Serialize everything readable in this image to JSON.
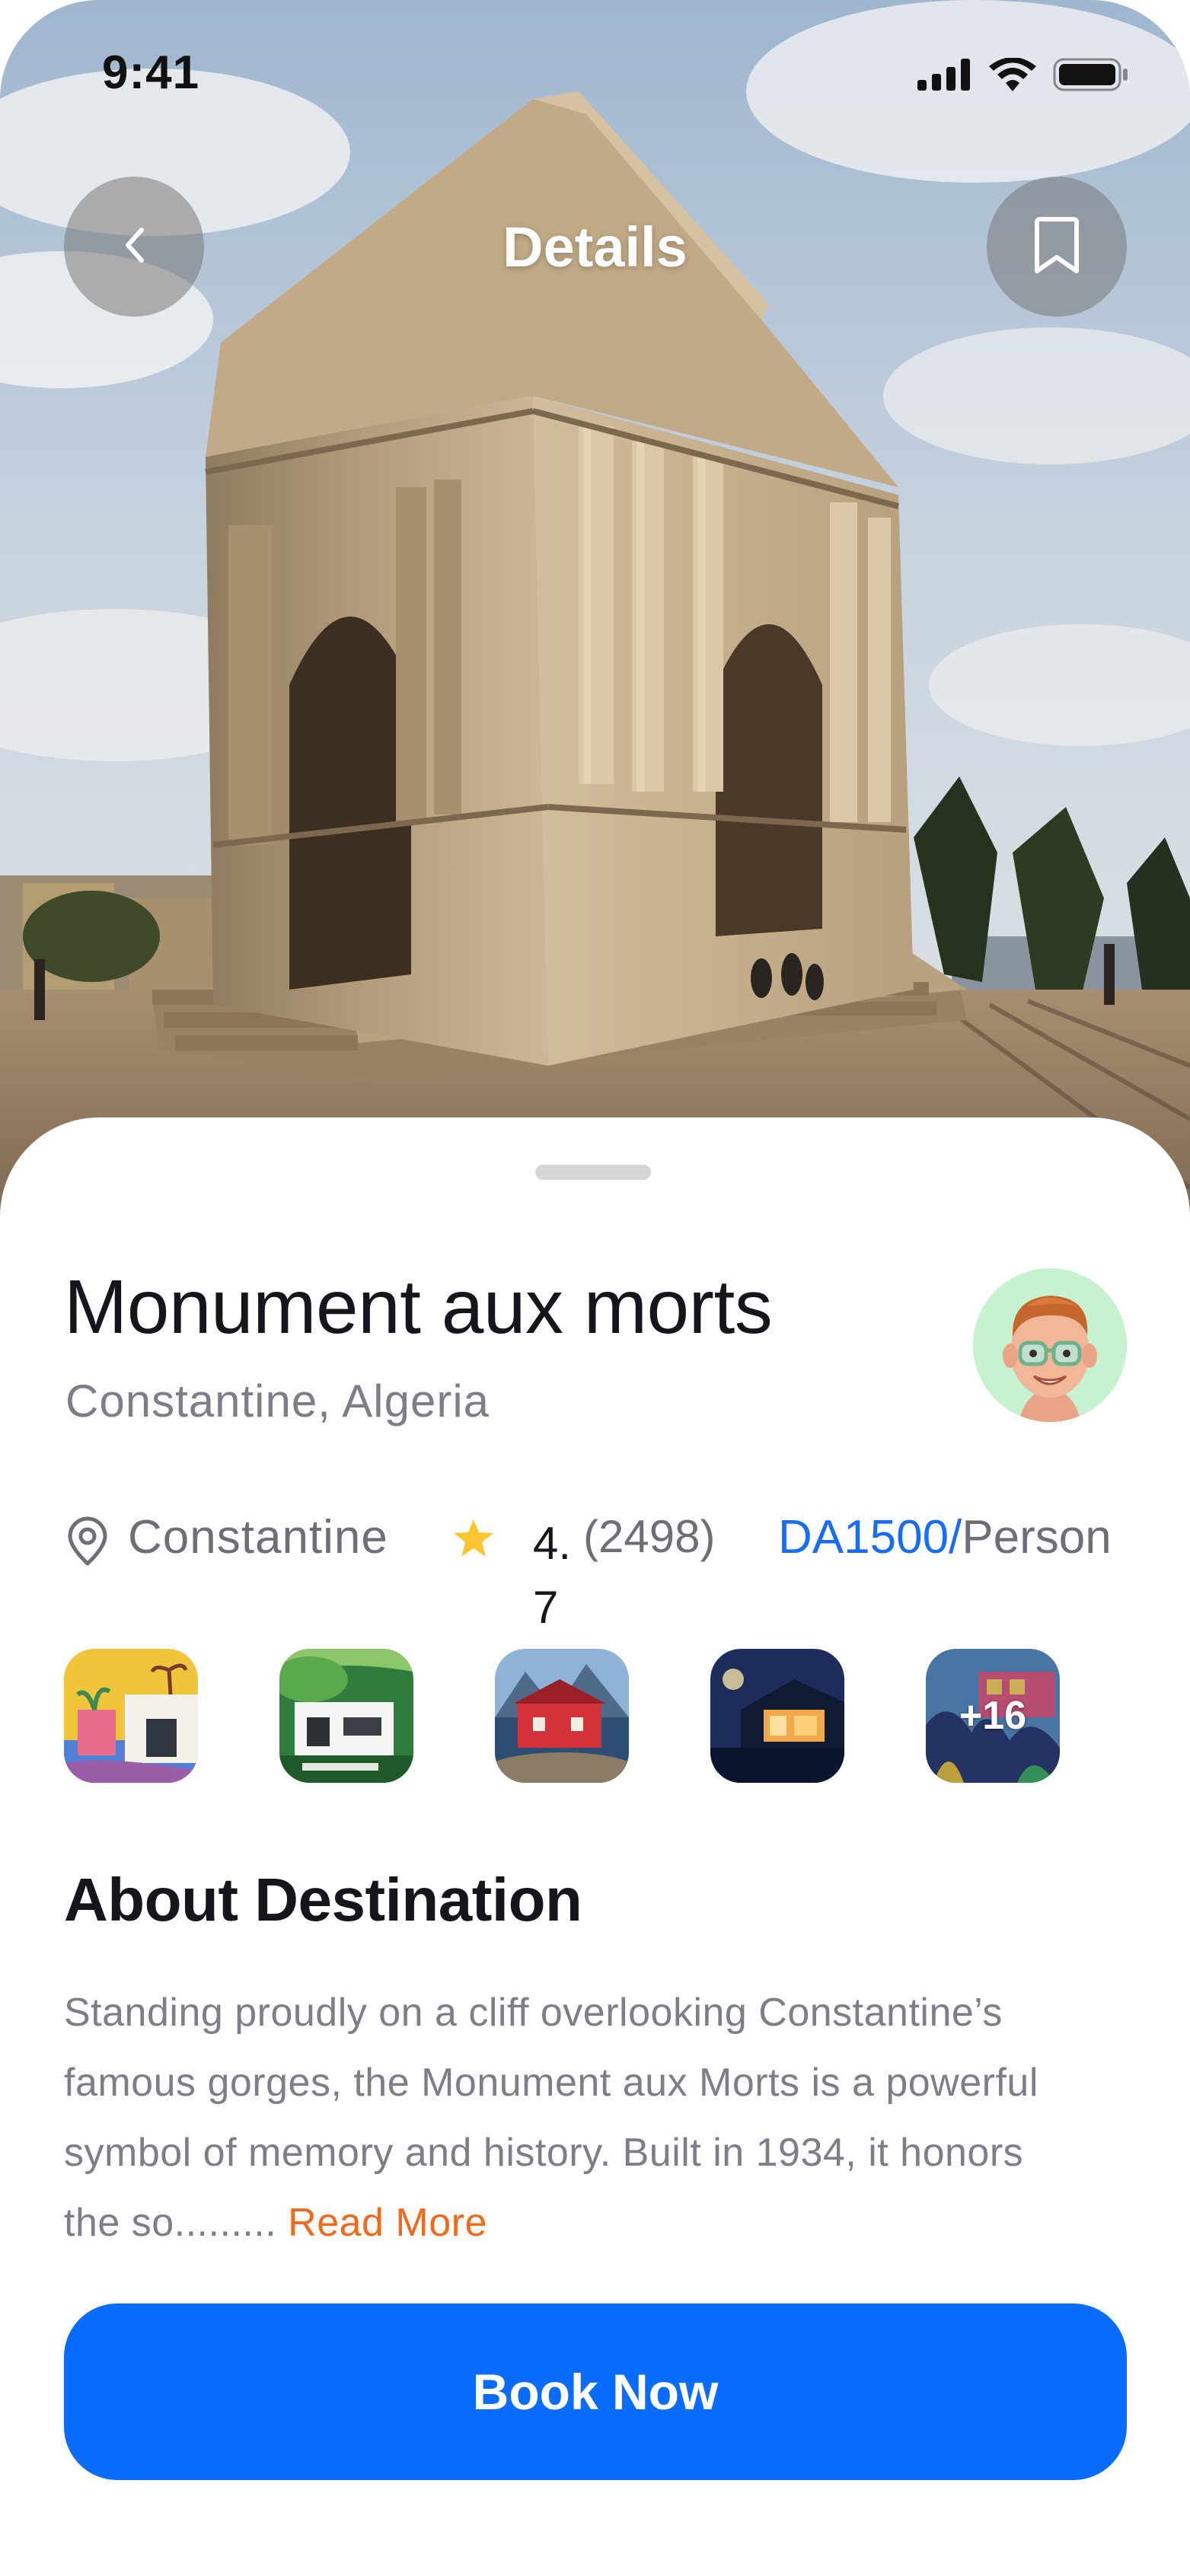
{
  "status_bar": {
    "time": "9:41"
  },
  "header": {
    "title": "Details",
    "back_icon": "chevron-left-icon",
    "bookmark_icon": "bookmark-icon"
  },
  "destination": {
    "name": "Monument aux morts",
    "region": "Constantine, Algeria",
    "city": "Constantine",
    "rating": "4.7",
    "reviews": "(2498)",
    "price_amount": "DA1500/",
    "price_unit": "Person"
  },
  "gallery": {
    "more_label": "+16"
  },
  "about": {
    "heading": "About Destination",
    "text": "Standing proudly on a cliff overlooking Constantine’s famous gorges, the Monument aux Morts is a powerful symbol of memory and history. Built in 1934, it honors the so......... ",
    "read_more": "Read More"
  },
  "cta": {
    "label": "Book Now"
  },
  "colors": {
    "accent": "#0A6CFF",
    "price": "#1A6CF4",
    "read_more": "#F06A1D",
    "star": "#FFC531",
    "avatar_bg": "#C7F2D0"
  }
}
